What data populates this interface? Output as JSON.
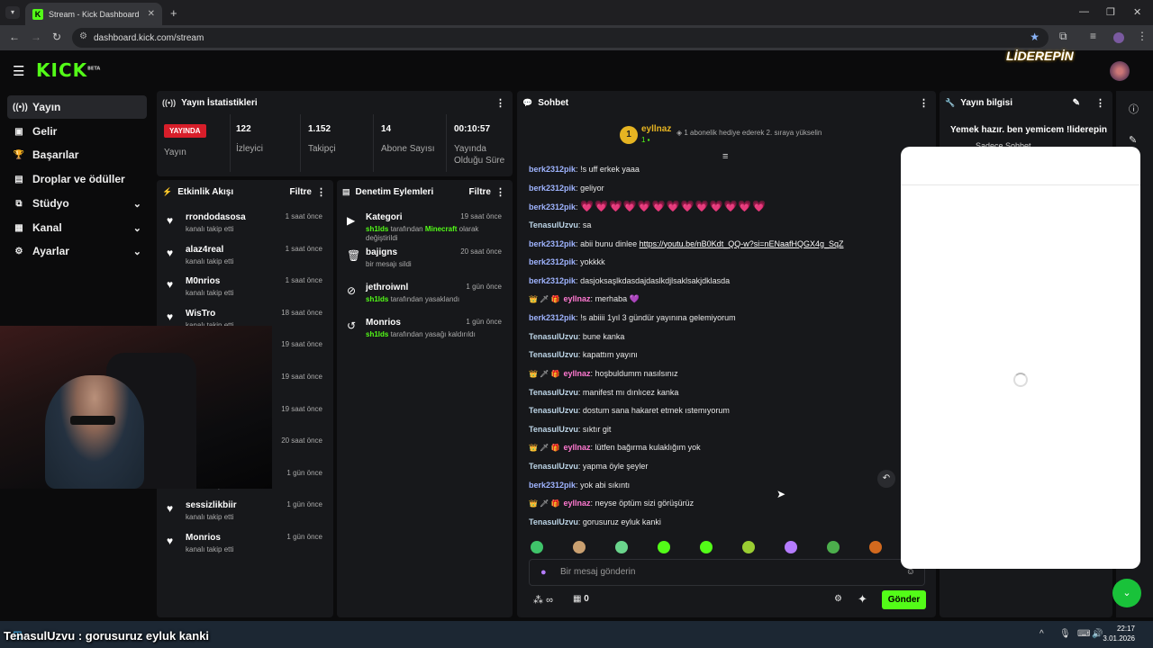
{
  "browser": {
    "tab_title": "Stream - Kick Dashboard",
    "tab_close": "✕",
    "new_tab": "+",
    "url": "dashboard.kick.com/stream",
    "win_min": "—",
    "win_max": "❐",
    "win_close": "✕"
  },
  "app": {
    "logo": "KICK",
    "logo_tag": "BETA",
    "brand_overlay": "LİDEREPİN",
    "accent": "#53fc18"
  },
  "sidebar": {
    "items": [
      {
        "label": "Yayın",
        "icon": "broadcast-icon"
      },
      {
        "label": "Gelir",
        "icon": "revenue-icon"
      },
      {
        "label": "Başarılar",
        "icon": "trophy-icon"
      },
      {
        "label": "Droplar ve ödüller",
        "icon": "gift-icon"
      },
      {
        "label": "Stüdyo",
        "icon": "studio-icon"
      },
      {
        "label": "Kanal",
        "icon": "channel-icon"
      },
      {
        "label": "Ayarlar",
        "icon": "settings-icon"
      }
    ]
  },
  "stats": {
    "title": "Yayın İstatistikleri",
    "live_badge": "YAYINDA",
    "live_label": "Yayın",
    "viewers": "122",
    "viewers_label": "İzleyici",
    "followers": "1.152",
    "followers_label": "Takipçi",
    "subs": "14",
    "subs_label": "Abone Sayısı",
    "duration": "00:10:57",
    "duration_label": "Yayında Olduğu Süre"
  },
  "activity": {
    "title": "Etkinlik Akışı",
    "filter": "Filtre",
    "items": [
      {
        "name": "rrondodasosa",
        "sub": "kanalı takip etti",
        "time": "1 saat önce"
      },
      {
        "name": "alaz4real",
        "sub": "kanalı takip etti",
        "time": "1 saat önce"
      },
      {
        "name": "M0nrios",
        "sub": "kanalı takip etti",
        "time": "1 saat önce"
      },
      {
        "name": "WisTro",
        "sub": "kanalı takip etti",
        "time": "18 saat önce"
      },
      {
        "name": "",
        "sub": "",
        "time": "19 saat önce"
      },
      {
        "name": "",
        "sub": "",
        "time": "19 saat önce"
      },
      {
        "name": "",
        "sub": "",
        "time": "19 saat önce"
      },
      {
        "name": "",
        "sub": "",
        "time": "20 saat önce"
      },
      {
        "name": "",
        "sub": "kanalı takip etti",
        "time": "1 gün önce"
      },
      {
        "name": "sessizlikbiir",
        "sub": "kanalı takip etti",
        "time": "1 gün önce"
      },
      {
        "name": "Monrios",
        "sub": "kanalı takip etti",
        "time": "1 gün önce"
      }
    ]
  },
  "moderation": {
    "title": "Denetim Eylemleri",
    "filter": "Filtre",
    "items": [
      {
        "name": "Kategori",
        "pre": "sh1lds",
        "mid": " tarafından ",
        "hl": "Minecraft",
        "post": " olarak değiştirildi",
        "time": "19 saat önce"
      },
      {
        "name": "bajigns",
        "pre": "",
        "mid": "bir mesajı sildi",
        "hl": "",
        "post": "",
        "time": "20 saat önce"
      },
      {
        "name": "jethroiwnl",
        "pre": "sh1lds",
        "mid": " tarafından yasaklandı",
        "hl": "",
        "post": "",
        "time": "1 gün önce"
      },
      {
        "name": "Monrios",
        "pre": "sh1lds",
        "mid": " tarafından yasağı kaldırıldı",
        "hl": "",
        "post": "",
        "time": "1 gün önce"
      }
    ]
  },
  "chat": {
    "title": "Sohbet",
    "pinned_rank": "1",
    "pinned_user": "eyllnaz",
    "pinned_count": "1",
    "pinned_text": "1 abonelik hediye ederek 2. sıraya yükselin",
    "messages": [
      {
        "user": "berk2312pik",
        "cls": "u1",
        "text": "!s uff erkek yaaa"
      },
      {
        "user": "berk2312pik",
        "cls": "u1",
        "text": "geliyor"
      },
      {
        "user": "berk2312pik",
        "cls": "u1",
        "text": "",
        "hearts": "💗💗💗💗💗💗💗💗💗💗💗💗💗"
      },
      {
        "user": "TenasulUzvu",
        "cls": "u2",
        "text": "sa"
      },
      {
        "user": "berk2312pik",
        "cls": "u1",
        "text": "abii bunu dinlee ",
        "link": "https://youtu.be/nB0Kdt_QQ-w?si=nENaafHQGX4g_SqZ"
      },
      {
        "user": "berk2312pik",
        "cls": "u1",
        "text": "yokkkk"
      },
      {
        "user": "berk2312pik",
        "cls": "u1",
        "text": "dasjoksaşlkdasdajdaslkdjlsaklsakjdklasda"
      },
      {
        "user": "eyllnaz",
        "cls": "u3",
        "badges": "👑 🗡 🎁",
        "text": "merhaba 💜"
      },
      {
        "user": "berk2312pik",
        "cls": "u1",
        "text": "!s abiiii 1yıl 3 gündür yayınına gelemiyorum"
      },
      {
        "user": "TenasulUzvu",
        "cls": "u2",
        "text": "bune kanka"
      },
      {
        "user": "TenasulUzvu",
        "cls": "u2",
        "text": "kapattım yayını"
      },
      {
        "user": "eyllnaz",
        "cls": "u3",
        "badges": "👑 🗡 🎁",
        "text": "hoşbuldumm nasılsınız"
      },
      {
        "user": "TenasulUzvu",
        "cls": "u2",
        "text": "manifest mı dınlıcez kanka"
      },
      {
        "user": "TenasulUzvu",
        "cls": "u2",
        "text": "dostum sana hakaret etmek ıstemıyorum"
      },
      {
        "user": "TenasulUzvu",
        "cls": "u2",
        "text": "sıktır git"
      },
      {
        "user": "eyllnaz",
        "cls": "u3",
        "badges": "👑 🗡 🎁",
        "text": "lütfen bağırma kulaklığım yok"
      },
      {
        "user": "TenasulUzvu",
        "cls": "u2",
        "text": "yapma öyle şeyler"
      },
      {
        "user": "berk2312pik",
        "cls": "u1",
        "text": "yok abi sıkıntı"
      },
      {
        "user": "eyllnaz",
        "cls": "u3",
        "badges": "👑 🗡 🎁",
        "text": "neyse öptüm sizi görüşürüz"
      },
      {
        "user": "TenasulUzvu",
        "cls": "u2",
        "text": "gorusuruz eyluk kanki"
      }
    ],
    "input_placeholder": "Bir mesaj gönderin",
    "infinity": "∞",
    "gift_count": "0",
    "send": "Gönder"
  },
  "stream_info": {
    "title": "Yayın bilgisi",
    "stream_title": "Yemek hazır. ben yemicem !liderepin",
    "category": "Sadece Sohbet"
  },
  "caption": "TenasulUzvu : gorusuruz eyluk kanki",
  "taskbar": {
    "time": "22:17",
    "date": "3.01.2026"
  }
}
